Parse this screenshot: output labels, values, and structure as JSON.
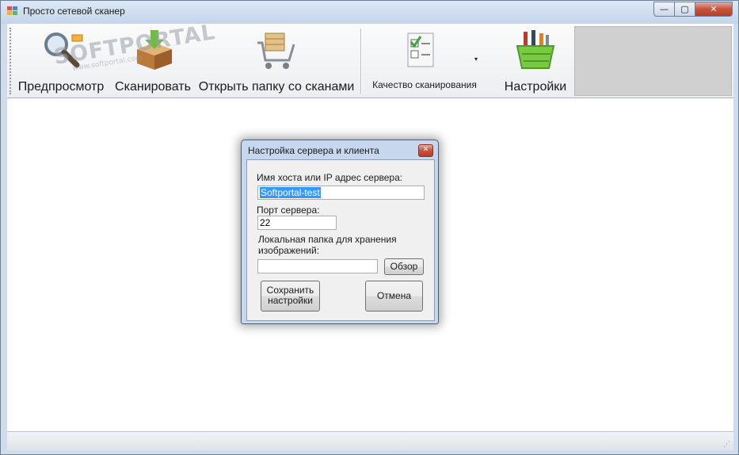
{
  "window": {
    "title": "Просто сетевой сканер",
    "min_glyph": "—",
    "max_glyph": "▢",
    "close_glyph": "✕"
  },
  "toolbar": {
    "preview_label": "Предпросмотр",
    "scan_label": "Сканировать",
    "open_folder_label": "Открыть папку со сканами",
    "quality_label": "Качество сканирования",
    "quality_arrow": "▾",
    "settings_label": "Настройки"
  },
  "watermark": {
    "text": "SOFTPORTAL",
    "url": "www.softportal.com",
    "tm": "™"
  },
  "dialog": {
    "title": "Настройка сервера и клиента",
    "close_glyph": "✕",
    "host_label": "Имя хоста или IP адрес сервера:",
    "host_value": "Softportal-test",
    "port_label": "Порт сервера:",
    "port_value": "22",
    "folder_label": "Локальная папка для хранения изображений:",
    "folder_value": "",
    "browse_label": "Обзор",
    "save_label": "Сохранить настройки",
    "cancel_label": "Отмена"
  },
  "statusbar": {
    "grip_glyph": "⋰"
  }
}
